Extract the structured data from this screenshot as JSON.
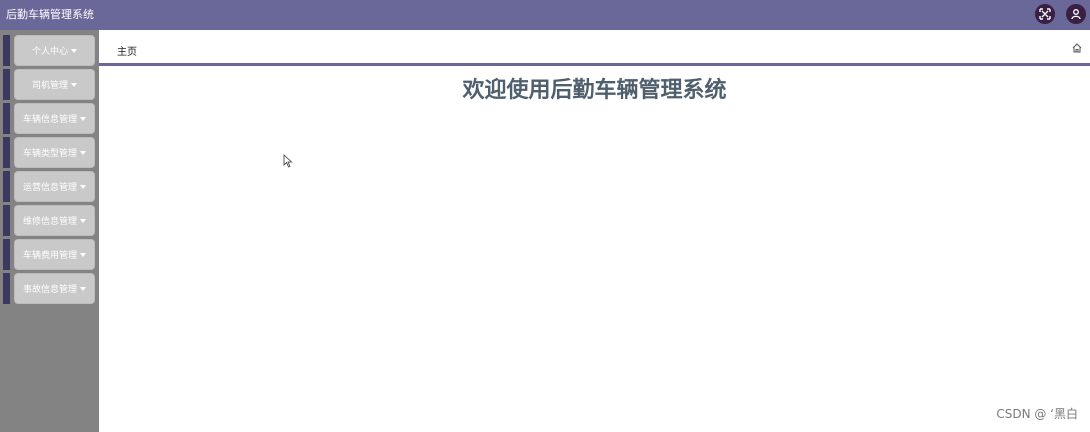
{
  "header": {
    "app_title": "后勤车辆管理系统",
    "icons": [
      "fullscreen-icon",
      "user-icon"
    ],
    "bg_color": "#6a6799"
  },
  "sidebar": {
    "items": [
      {
        "label": "个人中心"
      },
      {
        "label": "司机管理"
      },
      {
        "label": "车辆信息管理"
      },
      {
        "label": "车辆类型管理"
      },
      {
        "label": "运营信息管理"
      },
      {
        "label": "维修信息管理"
      },
      {
        "label": "车辆费用管理"
      },
      {
        "label": "事故信息管理"
      }
    ]
  },
  "tabs": {
    "active": "主页",
    "home_icon": "home-icon"
  },
  "main": {
    "welcome": "欢迎使用后勤车辆管理系统"
  },
  "watermark": "CSDN @ ‘黑白"
}
